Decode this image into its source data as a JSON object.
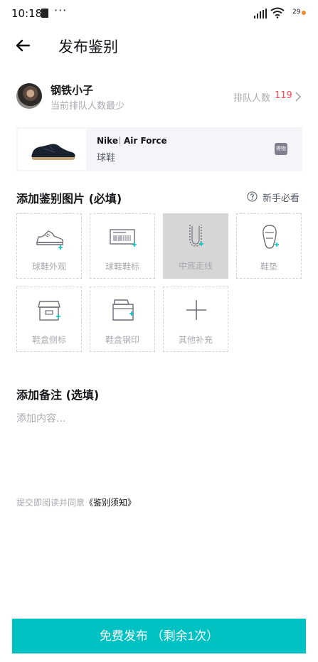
{
  "status_bar": {
    "time": "10:18",
    "dots": "···",
    "battery": "29"
  },
  "header": {
    "title": "发布鉴别"
  },
  "user": {
    "name": "钢铁小子",
    "subtitle": "当前排队人数最少",
    "queue_label": "排队人数",
    "queue_count": "119"
  },
  "product": {
    "brand": "Nike",
    "model": "Air Force",
    "category": "球鞋",
    "badge": "得物"
  },
  "photos_section": {
    "title": "添加鉴别图片 (必填)",
    "help_label": "新手必看",
    "tiles": [
      {
        "label": "球鞋外观",
        "icon": "sneaker-icon",
        "disabled": false
      },
      {
        "label": "球鞋鞋标",
        "icon": "barcode-tag-icon",
        "disabled": false
      },
      {
        "label": "中底走线",
        "icon": "midsole-stitch-icon",
        "disabled": true
      },
      {
        "label": "鞋垫",
        "icon": "insole-icon",
        "disabled": false
      },
      {
        "label": "鞋盒侧标",
        "icon": "shoebox-side-icon",
        "disabled": false
      },
      {
        "label": "鞋盒钢印",
        "icon": "shoebox-stamp-icon",
        "disabled": false
      },
      {
        "label": "其他补充",
        "icon": "plus-icon",
        "disabled": false
      }
    ]
  },
  "remark": {
    "title": "添加备注 (选填)",
    "placeholder": "添加内容...",
    "value": ""
  },
  "agreement": {
    "text": "提交即阅读并同意",
    "link": "《鉴别须知》"
  },
  "submit": {
    "label": "免费发布 （剩余1次）"
  },
  "colors": {
    "accent": "#01c2c3",
    "queue_count": "#ff4657",
    "tile_icon_plus": "#01c2c3"
  }
}
